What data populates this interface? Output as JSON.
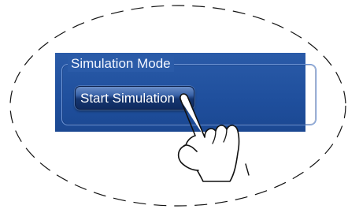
{
  "group": {
    "title": "Simulation Mode"
  },
  "buttons": {
    "start_label": "Start Simulation"
  },
  "icons": {
    "pointer": "hand-pointer-icon"
  }
}
